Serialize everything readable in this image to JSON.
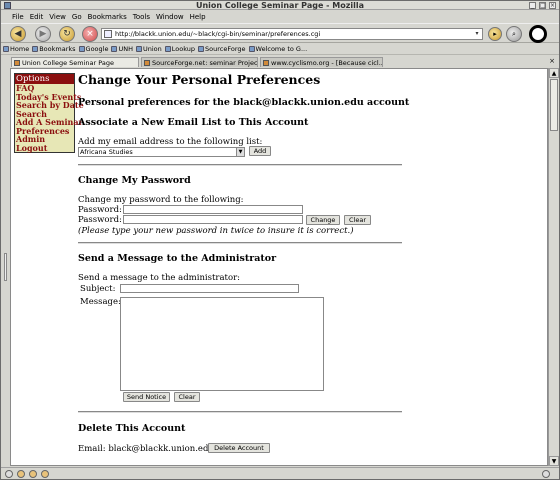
{
  "window": {
    "title": "Union College Seminar Page - Mozilla"
  },
  "menu": [
    "File",
    "Edit",
    "View",
    "Go",
    "Bookmarks",
    "Tools",
    "Window",
    "Help"
  ],
  "url": "http://blackk.union.edu/~black/cgi-bin/seminar/preferences.cgi",
  "bookmarks": [
    "Home",
    "Bookmarks",
    "Google",
    "UNH",
    "Union",
    "Lookup",
    "SourceForge",
    "Welcome to G..."
  ],
  "tabs": [
    {
      "label": "Union College Seminar Page"
    },
    {
      "label": "SourceForge.net: seminar Projec..."
    },
    {
      "label": "www.cyclismo.org - [Because cicl..."
    }
  ],
  "sidebar": {
    "heading": "Options",
    "items": [
      "FAQ",
      "Today's Events",
      "Search by Date",
      "Search",
      "Add A Seminar",
      "Preferences",
      "Admin",
      "Logout"
    ]
  },
  "page": {
    "title": "Change Your Personal Preferences",
    "subtitle": "Personal preferences for the black@blackk.union.edu account",
    "email_section": {
      "heading": "Associate a New Email List to This Account",
      "label": "Add my email address to the following list:",
      "selected": "Africana Studies",
      "add_label": "Add"
    },
    "password_section": {
      "heading": "Change My Password",
      "label": "Change my password to the following:",
      "password_label": "Password:",
      "change_label": "Change",
      "clear_label": "Clear",
      "note": "(Please type your new password in twice to insure it is correct.)"
    },
    "message_section": {
      "heading": "Send a Message to the Administrator",
      "label": "Send a message to the administrator:",
      "subject_label": "Subject:",
      "message_label": "Message:",
      "send_label": "Send Notice",
      "clear_label": "Clear"
    },
    "delete_section": {
      "heading": "Delete This Account",
      "email_text": "Email: black@blackk.union.edu",
      "delete_label": "Delete Account"
    }
  }
}
